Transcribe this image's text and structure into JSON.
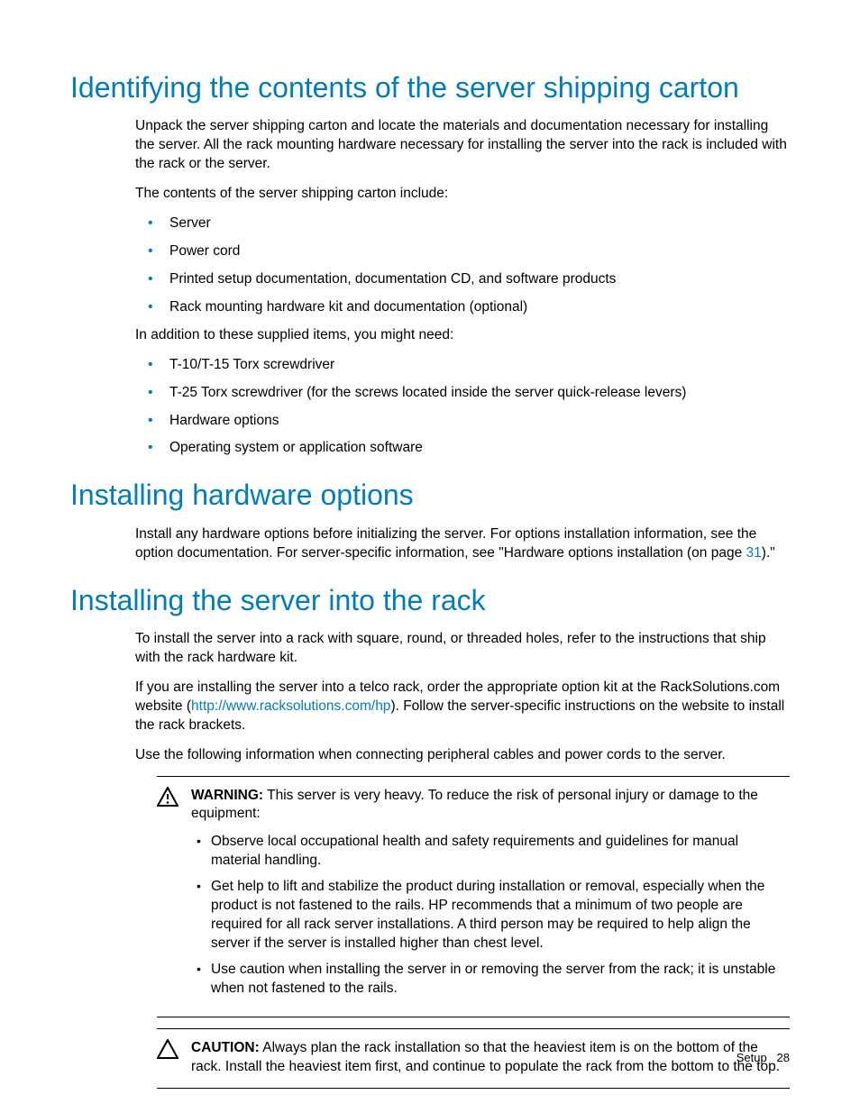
{
  "section1": {
    "heading": "Identifying the contents of the server shipping carton",
    "p1": "Unpack the server shipping carton and locate the materials and documentation necessary for installing the server. All the rack mounting hardware necessary for installing the server into the rack is included with the rack or the server.",
    "p2": "The contents of the server shipping carton include:",
    "list1": [
      "Server",
      "Power cord",
      "Printed setup documentation, documentation CD, and software products",
      "Rack mounting hardware kit and documentation (optional)"
    ],
    "p3": "In addition to these supplied items, you might need:",
    "list2": [
      "T-10/T-15 Torx screwdriver",
      "T-25 Torx screwdriver (for the screws located inside the server quick-release levers)",
      "Hardware options",
      "Operating system or application software"
    ]
  },
  "section2": {
    "heading": "Installing hardware options",
    "p1_a": "Install any hardware options before initializing the server. For options installation information, see the option documentation. For server-specific information, see \"Hardware options installation (on page ",
    "p1_link": "31",
    "p1_b": ").\""
  },
  "section3": {
    "heading": "Installing the server into the rack",
    "p1": "To install the server into a rack with square, round, or threaded holes, refer to the instructions that ship with the rack hardware kit.",
    "p2_a": "If you are installing the server into a telco rack, order the appropriate option kit at the RackSolutions.com website (",
    "p2_link": "http://www.racksolutions.com/hp",
    "p2_b": "). Follow the server-specific instructions on the website to install the rack brackets.",
    "p3": "Use the following information when connecting peripheral cables and power cords to the server."
  },
  "warning": {
    "label": "WARNING:",
    "text": "   This server is very heavy. To reduce the risk of personal injury or damage to the equipment:",
    "items": [
      "Observe local occupational health and safety requirements and guidelines for manual material handling.",
      "Get help to lift and stabilize the product during installation or removal, especially when the product is not fastened to the rails. HP recommends that a minimum of two people are required for all rack server installations. A third person may be required to help align the server if the server is installed higher than chest level.",
      "Use caution when installing the server in or removing the server from the rack; it is unstable when not fastened to the rails."
    ]
  },
  "caution": {
    "label": "CAUTION:",
    "text": "   Always plan the rack installation so that the heaviest item is on the bottom of the rack. Install the heaviest item first, and continue to populate the rack from the bottom to the top."
  },
  "footer": {
    "section": "Setup",
    "page": "28"
  }
}
